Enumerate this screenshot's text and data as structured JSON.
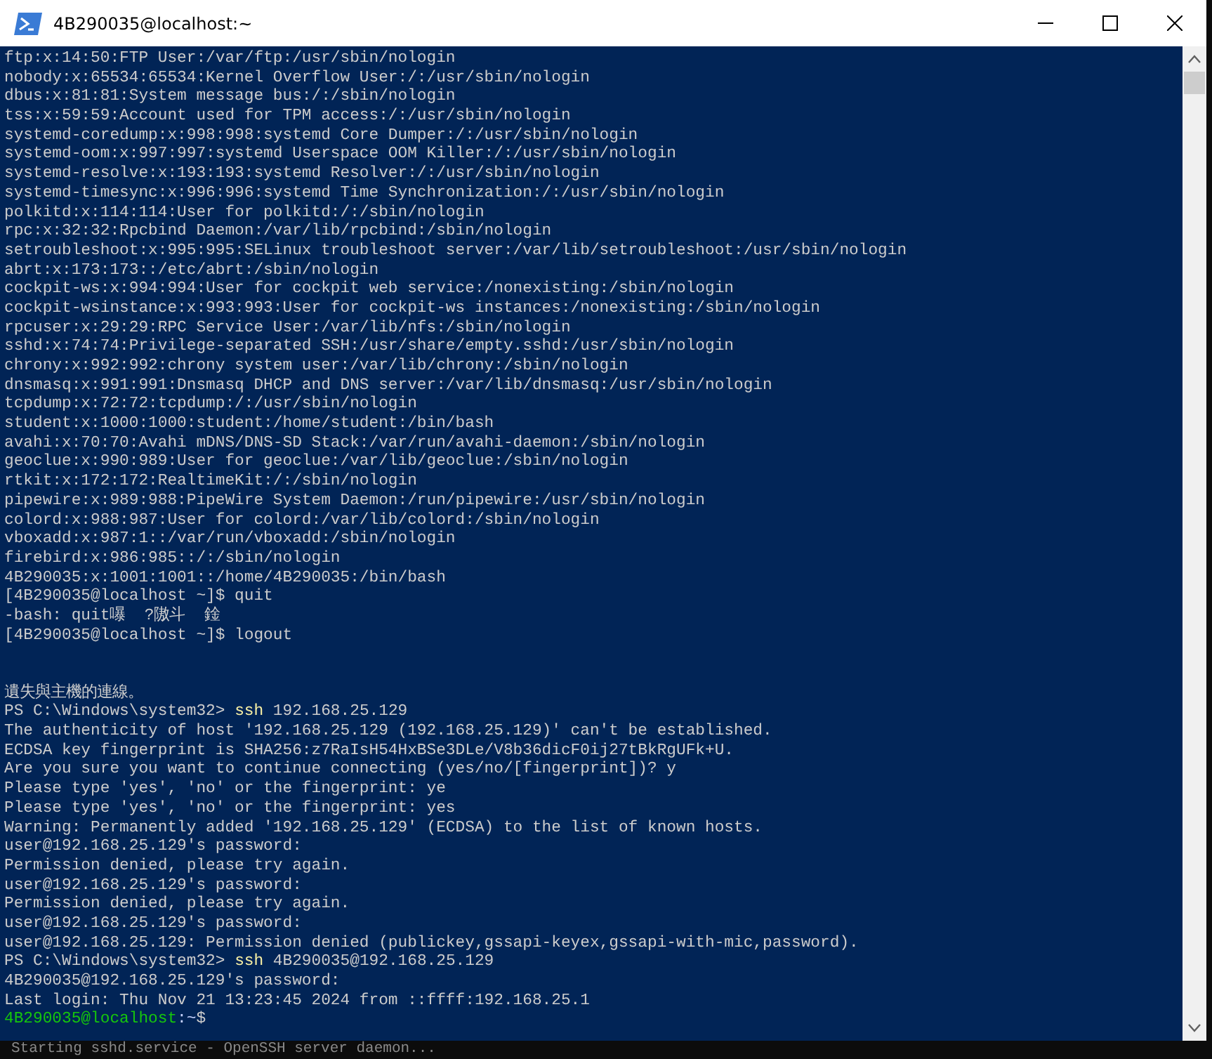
{
  "window": {
    "title": "4B290035@localhost:~"
  },
  "terminal": {
    "lines": [
      {
        "kind": "text",
        "text": "ftp:x:14:50:FTP User:/var/ftp:/usr/sbin/nologin"
      },
      {
        "kind": "text",
        "text": "nobody:x:65534:65534:Kernel Overflow User:/:/usr/sbin/nologin"
      },
      {
        "kind": "text",
        "text": "dbus:x:81:81:System message bus:/:/sbin/nologin"
      },
      {
        "kind": "text",
        "text": "tss:x:59:59:Account used for TPM access:/:/usr/sbin/nologin"
      },
      {
        "kind": "text",
        "text": "systemd-coredump:x:998:998:systemd Core Dumper:/:/usr/sbin/nologin"
      },
      {
        "kind": "text",
        "text": "systemd-oom:x:997:997:systemd Userspace OOM Killer:/:/usr/sbin/nologin"
      },
      {
        "kind": "text",
        "text": "systemd-resolve:x:193:193:systemd Resolver:/:/usr/sbin/nologin"
      },
      {
        "kind": "text",
        "text": "systemd-timesync:x:996:996:systemd Time Synchronization:/:/usr/sbin/nologin"
      },
      {
        "kind": "text",
        "text": "polkitd:x:114:114:User for polkitd:/:/sbin/nologin"
      },
      {
        "kind": "text",
        "text": "rpc:x:32:32:Rpcbind Daemon:/var/lib/rpcbind:/sbin/nologin"
      },
      {
        "kind": "text",
        "text": "setroubleshoot:x:995:995:SELinux troubleshoot server:/var/lib/setroubleshoot:/usr/sbin/nologin"
      },
      {
        "kind": "text",
        "text": "abrt:x:173:173::/etc/abrt:/sbin/nologin"
      },
      {
        "kind": "text",
        "text": "cockpit-ws:x:994:994:User for cockpit web service:/nonexisting:/sbin/nologin"
      },
      {
        "kind": "text",
        "text": "cockpit-wsinstance:x:993:993:User for cockpit-ws instances:/nonexisting:/sbin/nologin"
      },
      {
        "kind": "text",
        "text": "rpcuser:x:29:29:RPC Service User:/var/lib/nfs:/sbin/nologin"
      },
      {
        "kind": "text",
        "text": "sshd:x:74:74:Privilege-separated SSH:/usr/share/empty.sshd:/usr/sbin/nologin"
      },
      {
        "kind": "text",
        "text": "chrony:x:992:992:chrony system user:/var/lib/chrony:/sbin/nologin"
      },
      {
        "kind": "text",
        "text": "dnsmasq:x:991:991:Dnsmasq DHCP and DNS server:/var/lib/dnsmasq:/usr/sbin/nologin"
      },
      {
        "kind": "text",
        "text": "tcpdump:x:72:72:tcpdump:/:/usr/sbin/nologin"
      },
      {
        "kind": "text",
        "text": "student:x:1000:1000:student:/home/student:/bin/bash"
      },
      {
        "kind": "text",
        "text": "avahi:x:70:70:Avahi mDNS/DNS-SD Stack:/var/run/avahi-daemon:/sbin/nologin"
      },
      {
        "kind": "text",
        "text": "geoclue:x:990:989:User for geoclue:/var/lib/geoclue:/sbin/nologin"
      },
      {
        "kind": "text",
        "text": "rtkit:x:172:172:RealtimeKit:/:/sbin/nologin"
      },
      {
        "kind": "text",
        "text": "pipewire:x:989:988:PipeWire System Daemon:/run/pipewire:/usr/sbin/nologin"
      },
      {
        "kind": "text",
        "text": "colord:x:988:987:User for colord:/var/lib/colord:/sbin/nologin"
      },
      {
        "kind": "text",
        "text": "vboxadd:x:987:1::/var/run/vboxadd:/sbin/nologin"
      },
      {
        "kind": "text",
        "text": "firebird:x:986:985::/:/sbin/nologin"
      },
      {
        "kind": "text",
        "text": "4B290035:x:1001:1001::/home/4B290035:/bin/bash"
      },
      {
        "kind": "text",
        "text": "[4B290035@localhost ~]$ quit"
      },
      {
        "kind": "text",
        "text": "-bash: quit嚗  ?隞斗  鍂"
      },
      {
        "kind": "text",
        "text": "[4B290035@localhost ~]$ logout"
      },
      {
        "kind": "blank"
      },
      {
        "kind": "blank"
      },
      {
        "kind": "text",
        "text": "遺失與主機的連線。"
      },
      {
        "kind": "command",
        "prompt": "PS C:\\Windows\\system32>",
        "command": "ssh",
        "args": "192.168.25.129"
      },
      {
        "kind": "text",
        "text": "The authenticity of host '192.168.25.129 (192.168.25.129)' can't be established."
      },
      {
        "kind": "text",
        "text": "ECDSA key fingerprint is SHA256:z7RaIsH54HxBSe3DLe/V8b36dicF0ij27tBkRgUFk+U."
      },
      {
        "kind": "text",
        "text": "Are you sure you want to continue connecting (yes/no/[fingerprint])? y"
      },
      {
        "kind": "text",
        "text": "Please type 'yes', 'no' or the fingerprint: ye"
      },
      {
        "kind": "text",
        "text": "Please type 'yes', 'no' or the fingerprint: yes"
      },
      {
        "kind": "text",
        "text": "Warning: Permanently added '192.168.25.129' (ECDSA) to the list of known hosts."
      },
      {
        "kind": "text",
        "text": "user@192.168.25.129's password:"
      },
      {
        "kind": "text",
        "text": "Permission denied, please try again."
      },
      {
        "kind": "text",
        "text": "user@192.168.25.129's password:"
      },
      {
        "kind": "text",
        "text": "Permission denied, please try again."
      },
      {
        "kind": "text",
        "text": "user@192.168.25.129's password:"
      },
      {
        "kind": "text",
        "text": "user@192.168.25.129: Permission denied (publickey,gssapi-keyex,gssapi-with-mic,password)."
      },
      {
        "kind": "command",
        "prompt": "PS C:\\Windows\\system32>",
        "command": "ssh",
        "args": "4B290035@192.168.25.129"
      },
      {
        "kind": "text",
        "text": "4B290035@192.168.25.129's password:"
      },
      {
        "kind": "text",
        "text": "Last login: Thu Nov 21 13:23:45 2024 from ::ffff:192.168.25.1"
      },
      {
        "kind": "shell_prompt",
        "user_host": "4B290035@localhost",
        "path": ":~",
        "symbol": "$"
      }
    ]
  },
  "background_window": {
    "text": "Starting sshd.service - OpenSSH server daemon..."
  }
}
